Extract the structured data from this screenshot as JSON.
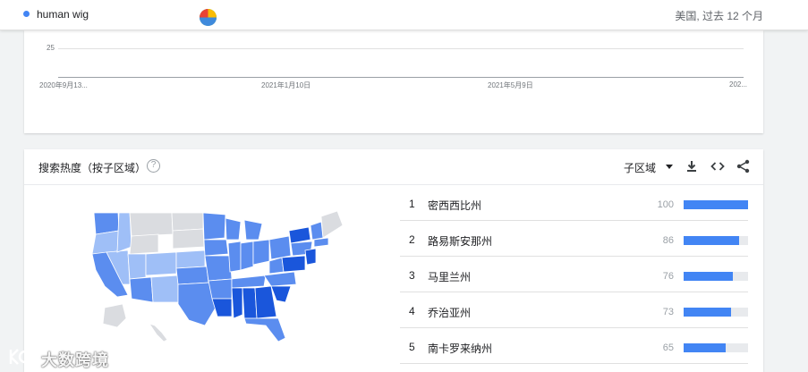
{
  "topbar": {
    "term": "human wig",
    "term_color": "#4285f4",
    "region_time": "美国, 过去 12 个月"
  },
  "interest_chart": {
    "y_tick": "25",
    "x_ticks": [
      "2020年9月13...",
      "2021年1月10日",
      "2021年5月9日",
      "202..."
    ]
  },
  "subregion": {
    "title": "搜索热度（按子区域）",
    "help_icon": "help-circle-icon",
    "selector_label": "子区域",
    "icons": [
      "download-icon",
      "embed-icon",
      "share-icon"
    ]
  },
  "rankings": [
    {
      "rank": "1",
      "name": "密西西比州",
      "value": "100",
      "pct": 100
    },
    {
      "rank": "2",
      "name": "路易斯安那州",
      "value": "86",
      "pct": 86
    },
    {
      "rank": "3",
      "name": "马里兰州",
      "value": "76",
      "pct": 76
    },
    {
      "rank": "4",
      "name": "乔治亚州",
      "value": "73",
      "pct": 73
    },
    {
      "rank": "5",
      "name": "南卡罗来纳州",
      "value": "65",
      "pct": 65
    }
  ],
  "colors": {
    "accent": "#4285f4",
    "map_dark": "#1a56db",
    "map_mid": "#5b8def",
    "map_light": "#9fbff7",
    "map_nodata": "#dadce0"
  },
  "watermark": {
    "text": "大数跨境"
  }
}
